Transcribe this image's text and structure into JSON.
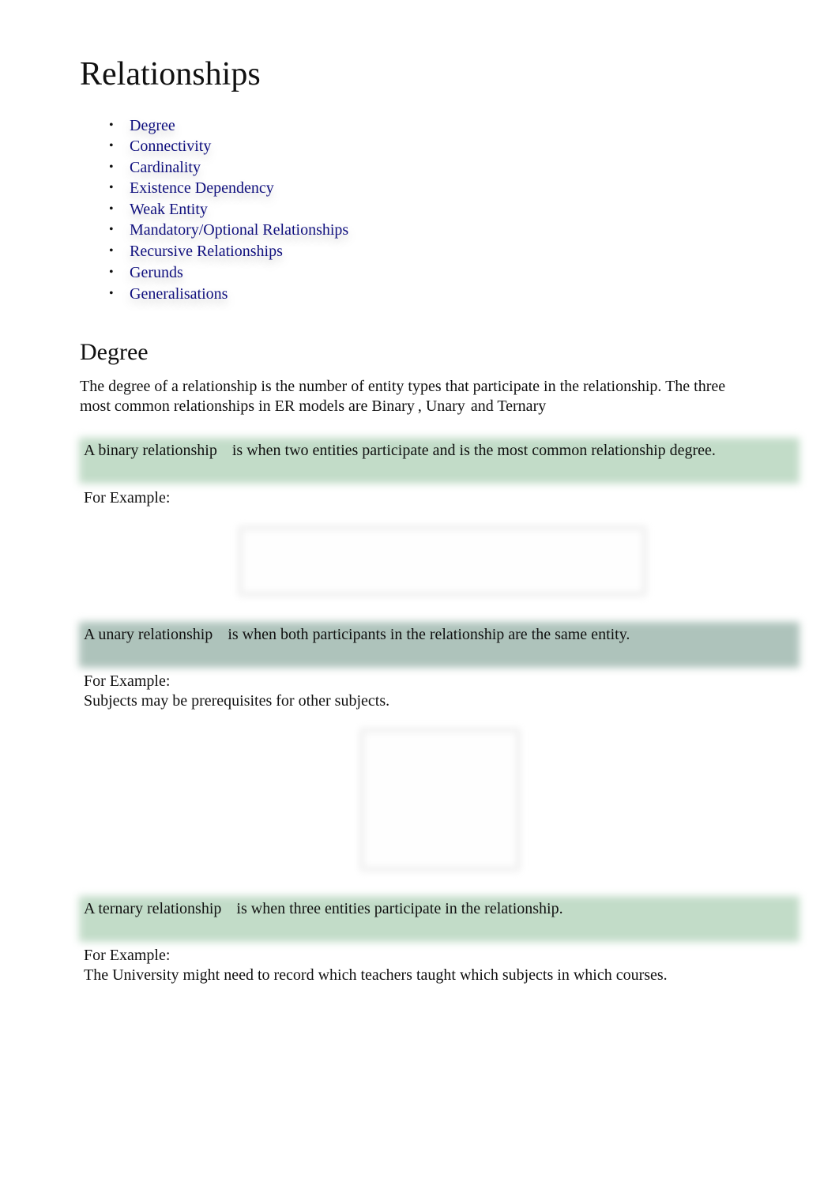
{
  "page": {
    "title": "Relationships"
  },
  "toc": {
    "bullet": "•",
    "items": [
      {
        "label": "Degree"
      },
      {
        "label": "Connectivity"
      },
      {
        "label": "Cardinality"
      },
      {
        "label": "Existence Dependency"
      },
      {
        "label": "Weak Entity"
      },
      {
        "label": "Mandatory/Optional Relationships"
      },
      {
        "label": "Recursive Relationships"
      },
      {
        "label": "Gerunds"
      },
      {
        "label": "Generalisations"
      }
    ]
  },
  "degree": {
    "title": "Degree",
    "intro_line1": "The degree of a relationship is the number of entity types that participate in the relationship. The three",
    "intro_line2_prefix": "most common relationships in ER models are Binary",
    "intro_sep1": ",",
    "intro_unary": "Unary",
    "intro_and_ternary": "and Ternary",
    "binary": {
      "term": "A binary relationship",
      "definition": "is when two entities participate and is the most common relationship degree.",
      "example_label": "For Example:",
      "example_text": ""
    },
    "unary": {
      "term": "A unary relationship",
      "definition": "is when both participants in the relationship are the same entity.",
      "example_label": "For Example:",
      "example_text": "Subjects may be prerequisites for other subjects."
    },
    "ternary": {
      "term": "A ternary relationship",
      "definition": "is when three entities participate in the relationship.",
      "example_label": "For Example:",
      "example_text": "The University might need to record which teachers taught which subjects in which courses."
    }
  },
  "colors": {
    "link": "#10107e",
    "callout_green": "#c2dcc8",
    "callout_gray": "#aec3bb",
    "text": "#111111"
  }
}
